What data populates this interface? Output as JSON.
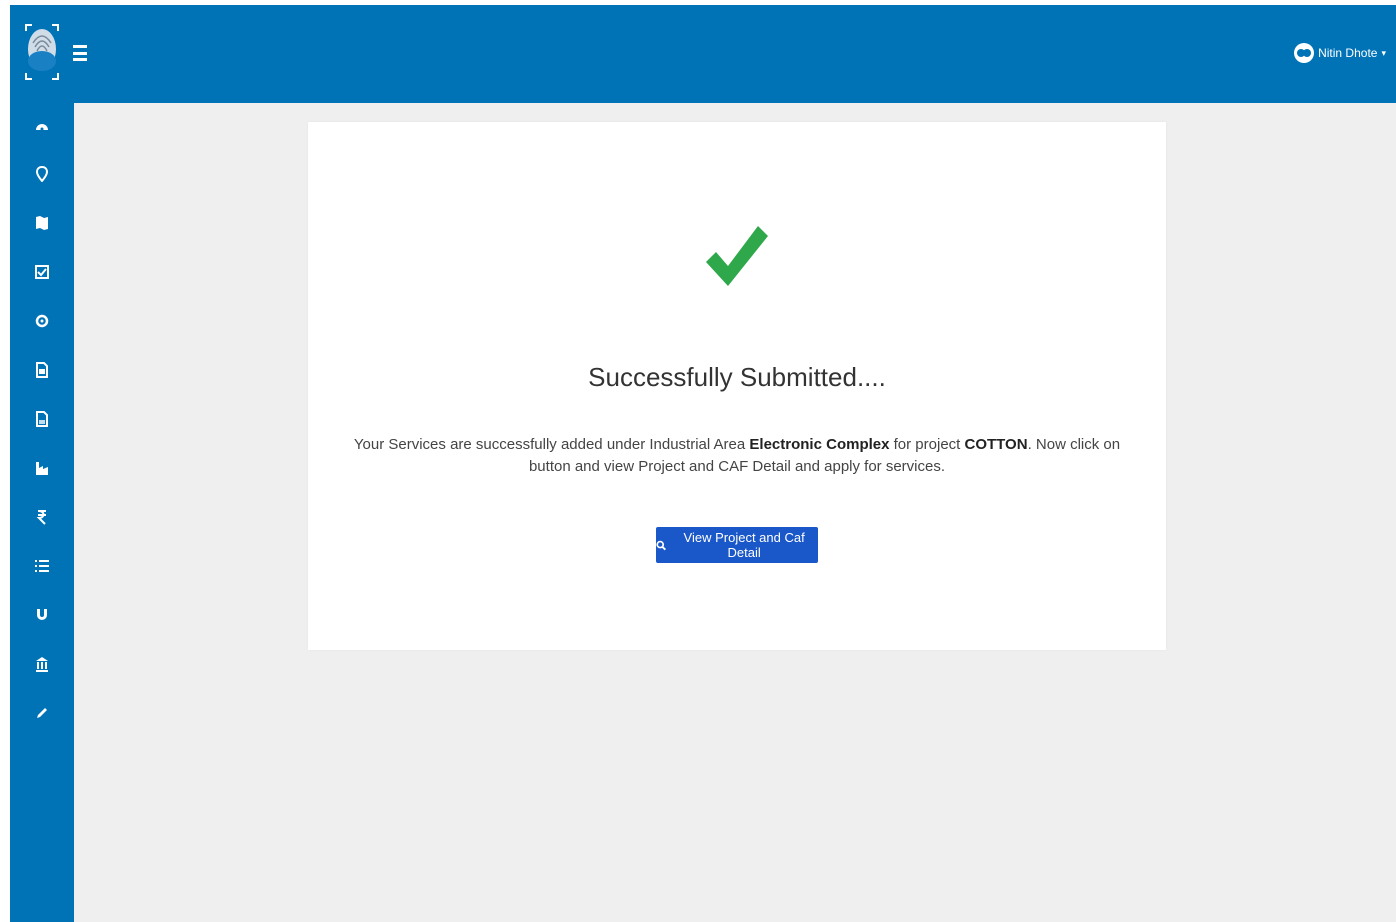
{
  "header": {
    "user_name": "Nitin Dhote",
    "user_caret": "▾"
  },
  "sidebar": {
    "items": [
      {
        "icon": "dashboard-icon"
      },
      {
        "icon": "location-pin-icon"
      },
      {
        "icon": "map-icon"
      },
      {
        "icon": "checklist-icon"
      },
      {
        "icon": "settings-icon"
      },
      {
        "icon": "document-icon"
      },
      {
        "icon": "report-icon"
      },
      {
        "icon": "industry-icon"
      },
      {
        "icon": "rupee-icon"
      },
      {
        "icon": "list-icon"
      },
      {
        "icon": "magnet-icon"
      },
      {
        "icon": "bank-icon"
      },
      {
        "icon": "pencil-icon"
      }
    ]
  },
  "main": {
    "title": "Successfully Submitted....",
    "message_prefix": "Your Services are successfully added under Industrial Area ",
    "industrial_area": "Electronic Complex",
    "message_middle": " for project ",
    "project": "COTTON",
    "message_suffix": ". Now click on button and view Project and CAF Detail and apply for services.",
    "button_label": "View Project and Caf Detail"
  },
  "colors": {
    "brand": "#0073b7",
    "success": "#2ea84a",
    "button": "#1a57c9",
    "background": "#efefef"
  }
}
